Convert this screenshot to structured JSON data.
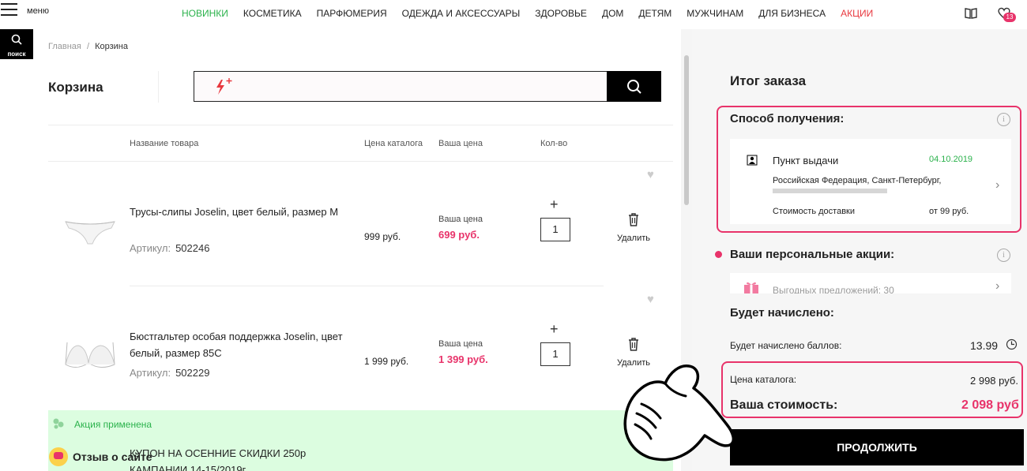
{
  "header": {
    "menu_label": "меню",
    "search_label": "поиск",
    "nav": [
      {
        "label": "НОВИНКИ",
        "kind": "green"
      },
      {
        "label": "КОСМЕТИКА",
        "kind": "normal"
      },
      {
        "label": "ПАРФЮМЕРИЯ",
        "kind": "normal"
      },
      {
        "label": "ОДЕЖДА И АКСЕССУАРЫ",
        "kind": "normal"
      },
      {
        "label": "ЗДОРОВЬЕ",
        "kind": "normal"
      },
      {
        "label": "ДОМ",
        "kind": "normal"
      },
      {
        "label": "ДЕТЯМ",
        "kind": "normal"
      },
      {
        "label": "МУЖЧИНАМ",
        "kind": "normal"
      },
      {
        "label": "ДЛЯ БИЗНЕСА",
        "kind": "normal"
      },
      {
        "label": "АКЦИИ",
        "kind": "red"
      }
    ],
    "favorites_count": "13"
  },
  "breadcrumb": {
    "home": "Главная",
    "separator": "/",
    "current": "Корзина"
  },
  "page_title": "Корзина",
  "quick_add": {
    "placeholder": ""
  },
  "table": {
    "col_name": "Название товара",
    "col_catalog_price": "Цена каталога",
    "col_your_price": "Ваша цена",
    "col_qty": "Кол-во"
  },
  "items": [
    {
      "name": "Трусы-слипы Joselin, цвет белый, размер M",
      "sku_label": "Артикул:",
      "sku": "502246",
      "catalog_price": "999 руб.",
      "your_price_label": "Ваша цена",
      "your_price": "699 руб.",
      "qty": "1",
      "plus": "+",
      "delete_label": "Удалить"
    },
    {
      "name": "Бюстгальтер особая поддержка Joselin, цвет белый, размер 85C",
      "sku_label": "Артикул:",
      "sku": "502229",
      "catalog_price": "1 999 руб.",
      "your_price_label": "Ваша цена",
      "your_price": "1 399 руб.",
      "qty": "1",
      "plus": "+",
      "delete_label": "Удалить"
    }
  ],
  "promo": {
    "applied": "Акция применена",
    "coupon_line1": "КУПОН НА ОСЕННИЕ СКИДКИ 250р",
    "coupon_line2": "КАМПАНИИ 14-15/2019г"
  },
  "feedback": "Отзыв о сайте",
  "sidebar": {
    "title": "Итог заказа",
    "delivery": {
      "heading": "Способ получения:",
      "method": "Пункт выдачи",
      "date": "04.10.2019",
      "address": "Российская Федерация, Санкт-Петербург,",
      "cost_label": "Стоимость доставки",
      "cost_value": "от 99 руб."
    },
    "personal": {
      "heading": "Ваши персональные акции:",
      "item_text": "Выгодных предложений: 30"
    },
    "accrual": {
      "heading": "Будет начислено:",
      "points_label": "Будет начислено баллов:",
      "points_value": "13.99"
    },
    "totals": {
      "catalog_label": "Цена каталога:",
      "catalog_value": "2 998 руб.",
      "yours_label": "Ваша стоимость:",
      "yours_value": "2 098 руб."
    },
    "continue_button": "ПРОДОЛЖИТЬ"
  },
  "colors": {
    "accent": "#e8336a",
    "green": "#2bb24c",
    "promo_bg": "#dcfde0",
    "sidebar_bg": "#f6f6f6"
  }
}
